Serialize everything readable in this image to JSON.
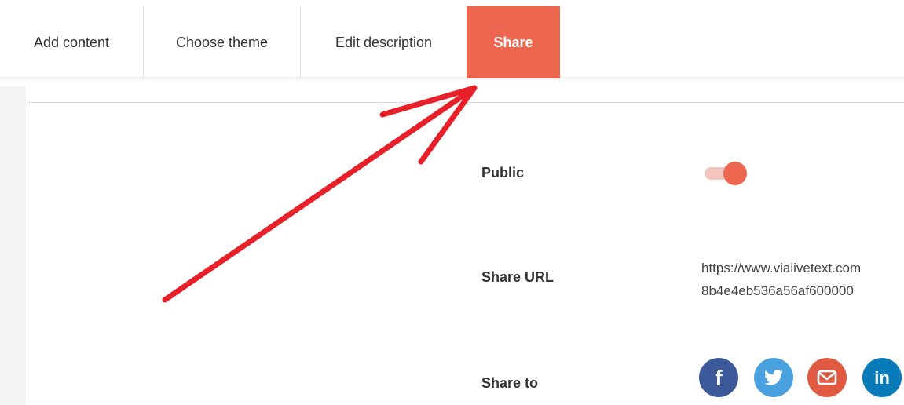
{
  "tabs": [
    {
      "label": "Add content",
      "active": false
    },
    {
      "label": "Choose theme",
      "active": false
    },
    {
      "label": "Edit description",
      "active": false
    },
    {
      "label": "Share",
      "active": true
    }
  ],
  "share_panel": {
    "public": {
      "label": "Public",
      "enabled": true
    },
    "share_url": {
      "label": "Share URL",
      "value_lines": [
        "https://www.vialivetext.com",
        "8b4e4eb536a56af600000"
      ]
    },
    "share_to": {
      "label": "Share to",
      "networks": [
        {
          "icon": "facebook-icon",
          "glyph": "f",
          "color": "#3b5998"
        },
        {
          "icon": "twitter-icon",
          "color": "#4aa1e0"
        },
        {
          "icon": "email-icon",
          "color": "#e05a41"
        },
        {
          "icon": "linkedin-icon",
          "glyph": "in",
          "color": "#0a7bb9"
        }
      ]
    }
  },
  "colors": {
    "accent": "#ec6650",
    "annotation_arrow": "#e8202a"
  }
}
